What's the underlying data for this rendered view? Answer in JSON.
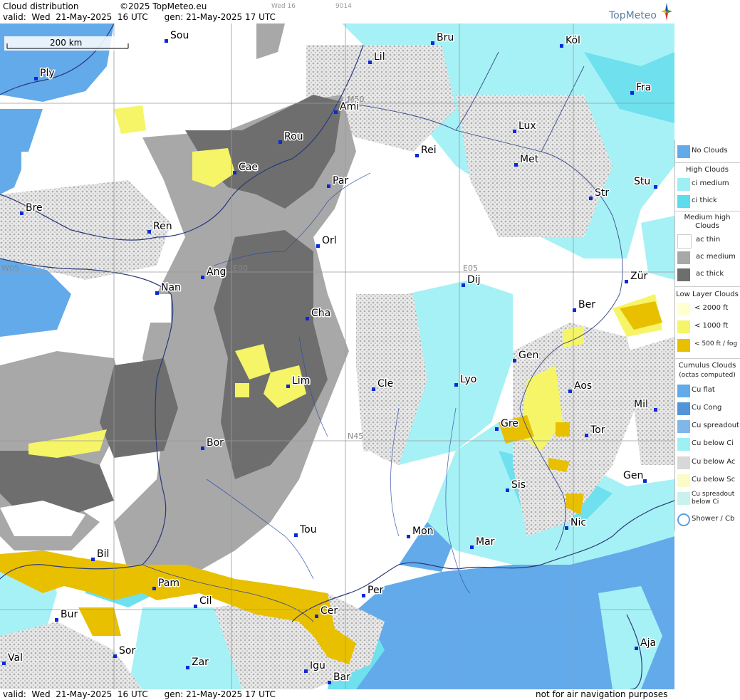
{
  "header": {
    "title": "Cloud distribution",
    "copyright": "©2025 TopMeteo.eu",
    "day_small": "Wed 16",
    "code_small": "9014",
    "valid_line": "valid:  Wed  21-May-2025  16 UTC      gen: 21-May-2025 17 UTC",
    "logo": "TopMeteo"
  },
  "footer": {
    "valid_line": "valid:  Wed  21-May-2025  16 UTC      gen: 21-May-2025 17 UTC",
    "disclaimer": "not for air navigation purposes"
  },
  "scale": {
    "label": "200 km"
  },
  "grid_labels": [
    "M50",
    "E00",
    "E05",
    "W05",
    "N45"
  ],
  "cities": [
    "Sou",
    "Bru",
    "Köl",
    "Lil",
    "Ply",
    "Ami",
    "Fra",
    "Rou",
    "Lux",
    "Cae",
    "Rei",
    "Met",
    "Par",
    "Stu",
    "Bre",
    "Str",
    "Ren",
    "Orl",
    "Ang",
    "Zür",
    "Nan",
    "Dij",
    "Ber",
    "Cha",
    "Gen",
    "Lim",
    "Cle",
    "Lyo",
    "Aos",
    "Mil",
    "Gre",
    "Tor",
    "Bor",
    "Sis",
    "Gen",
    "Nic",
    "Tou",
    "Mon",
    "Mar",
    "Bil",
    "Pam",
    "Cil",
    "Per",
    "Cer",
    "Bur",
    "Sor",
    "Val",
    "Zar",
    "Aja",
    "Igu",
    "Bar"
  ],
  "legend": {
    "sections": [
      "High Clouds",
      "Medium high Clouds",
      "Low Layer Clouds",
      "Cumulus Clouds",
      "(octas computed)"
    ],
    "items": [
      "No Clouds",
      "ci medium",
      "ci thick",
      "ac thin",
      "ac medium",
      "ac thick",
      "< 2000 ft",
      "< 1000 ft",
      "< 500 ft / fog",
      "Cu flat",
      "Cu Cong",
      "Cu spreadout",
      "Cu below Ci",
      "Cu below Ac",
      "Cu below Sc",
      "Cu spreadout below Ci",
      "Shower / Cb"
    ],
    "colors": {
      "no_clouds": "#63aaea",
      "ci_medium": "#9ff0f4",
      "ci_thick": "#5cdcec",
      "ac_thin": "#ffffff",
      "ac_medium": "#a8a8a8",
      "ac_thick": "#6e6e6e",
      "low_2000": "#ffffd0",
      "low_1000": "#f5f567",
      "low_500": "#e8c000"
    }
  }
}
